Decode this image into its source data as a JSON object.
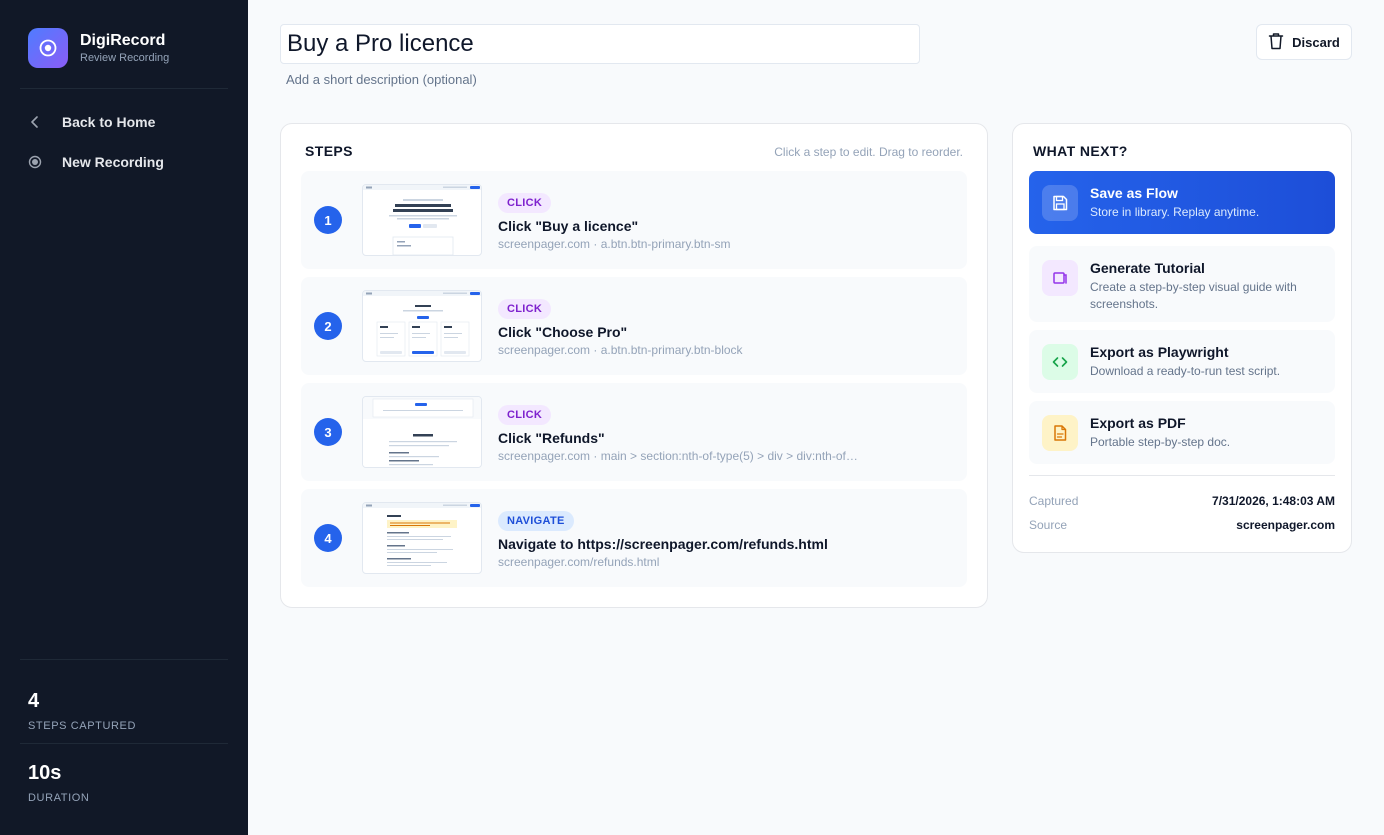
{
  "app": {
    "name": "DigiRecord",
    "subtitle": "Review Recording"
  },
  "nav": {
    "back_label": "Back to Home",
    "new_label": "New Recording"
  },
  "stats": {
    "steps_value": "4",
    "steps_label": "STEPS CAPTURED",
    "duration_value": "10s",
    "duration_label": "DURATION"
  },
  "header": {
    "title_value": "Buy a Pro licence",
    "description_placeholder": "Add a short description (optional)",
    "discard_label": "Discard"
  },
  "steps_panel": {
    "title": "STEPS",
    "hint": "Click a step to edit. Drag to reorder.",
    "steps": [
      {
        "number": "1",
        "type": "CLICK",
        "title": "Click \"Buy a licence\"",
        "meta": "screenpager.com · a.btn.btn-primary.btn-sm"
      },
      {
        "number": "2",
        "type": "CLICK",
        "title": "Click \"Choose Pro\"",
        "meta": "screenpager.com · a.btn.btn-primary.btn-block"
      },
      {
        "number": "3",
        "type": "CLICK",
        "title": "Click \"Refunds\"",
        "meta": "screenpager.com · main > section:nth-of-type(5) > div > div:nth-of-..."
      },
      {
        "number": "4",
        "type": "NAVIGATE",
        "title": "Navigate to https://screenpager.com/refunds.html",
        "meta": "screenpager.com/refunds.html"
      }
    ]
  },
  "next_panel": {
    "title": "WHAT NEXT?",
    "actions": [
      {
        "title": "Save as Flow",
        "desc": "Store in library. Replay anytime.",
        "icon": "save-icon",
        "color": "#2563eb"
      },
      {
        "title": "Generate Tutorial",
        "desc": "Create a step-by-step visual guide with screenshots.",
        "icon": "tutorial-icon",
        "color": "#9333ea"
      },
      {
        "title": "Export as Playwright",
        "desc": "Download a ready-to-run test script.",
        "icon": "code-icon",
        "color": "#16a34a"
      },
      {
        "title": "Export as PDF",
        "desc": "Portable step-by-step doc.",
        "icon": "pdf-file-icon",
        "color": "#d97706"
      }
    ],
    "captured_label": "Captured",
    "captured_value": "7/31/2026, 1:48:03 AM",
    "source_label": "Source",
    "source_value": "screenpager.com"
  }
}
